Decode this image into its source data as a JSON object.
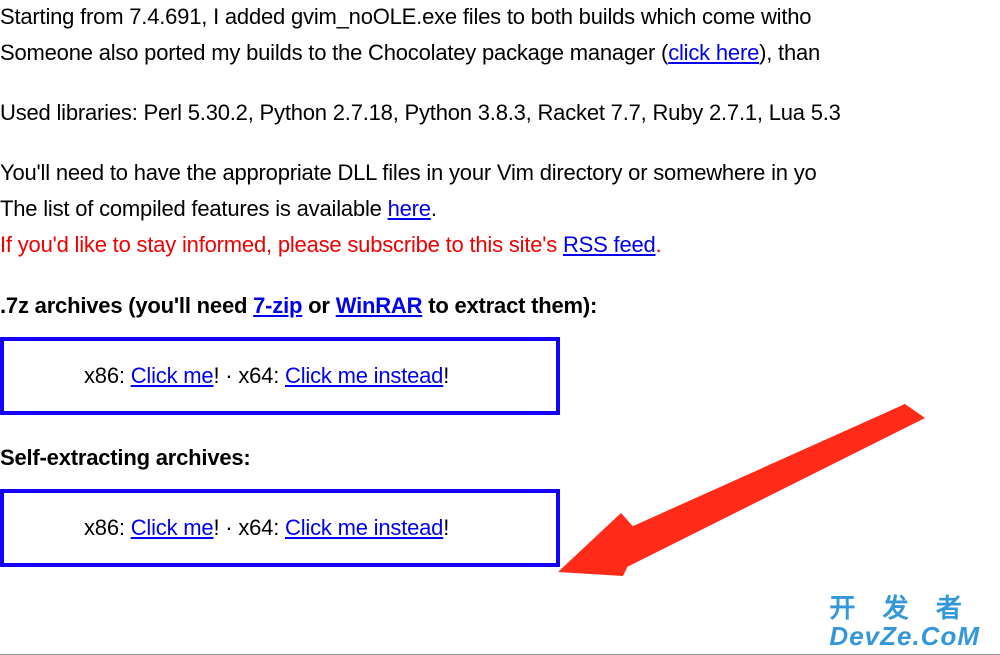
{
  "para1": {
    "line1": "Starting from 7.4.691, I added gvim_noOLE.exe files to both builds which come witho",
    "line2_before": "Someone also ported my builds to the Chocolatey package manager (",
    "link": "click here",
    "line2_after": "), than"
  },
  "para2": "Used libraries: Perl 5.30.2, Python 2.7.18, Python 3.8.3, Racket 7.7, Ruby 2.7.1, Lua 5.3",
  "para3": {
    "line1": "You'll need to have the appropriate DLL files in your Vim directory or somewhere in yo",
    "line2_before": "The list of compiled features is available ",
    "link": "here",
    "line2_after": "."
  },
  "para4": {
    "before": "If you'd like to stay informed, please subscribe to this site's ",
    "link": "RSS feed",
    "after": "."
  },
  "heading1": {
    "before": ".7z archives (you'll need ",
    "link1": "7-zip",
    "mid": " or ",
    "link2": "WinRAR",
    "after": " to extract them):"
  },
  "box1": {
    "x86_label": "x86: ",
    "x86_link": "Click me",
    "sep_a": "! · ",
    "x64_label": "x64: ",
    "x64_link": "Click me instead",
    "sep_b": "!"
  },
  "heading2": "Self-extracting archives:",
  "box2": {
    "x86_label": "x86: ",
    "x86_link": "Click me",
    "sep_a": "! · ",
    "x64_label": "x64: ",
    "x64_link": "Click me instead",
    "sep_b": "!"
  },
  "watermark": {
    "row1": "开 发 者",
    "row2": "DevZe.CoM"
  }
}
